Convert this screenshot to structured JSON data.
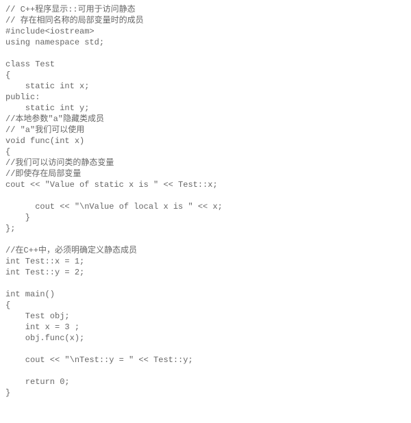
{
  "code": {
    "lines": [
      "// C++程序显示::可用于访问静态",
      "// 存在相同名称的局部变量时的成员",
      "#include<iostream>",
      "using namespace std;",
      "",
      "class Test",
      "{",
      "    static int x;",
      "public:",
      "    static int y;",
      "//本地参数\"a\"隐藏类成员",
      "// \"a\"我们可以使用",
      "void func(int x)",
      "{",
      "//我们可以访问类的静态变量",
      "//即使存在局部变量",
      "cout << \"Value of static x is \" << Test::x;",
      "",
      "      cout << \"\\nValue of local x is \" << x;",
      "    }",
      "};",
      "",
      "//在C++中，必须明确定义静态成员",
      "int Test::x = 1;",
      "int Test::y = 2;",
      "",
      "int main()",
      "{",
      "    Test obj;",
      "    int x = 3 ;",
      "    obj.func(x);",
      "",
      "    cout << \"\\nTest::y = \" << Test::y;",
      "",
      "    return 0;",
      "}"
    ]
  }
}
